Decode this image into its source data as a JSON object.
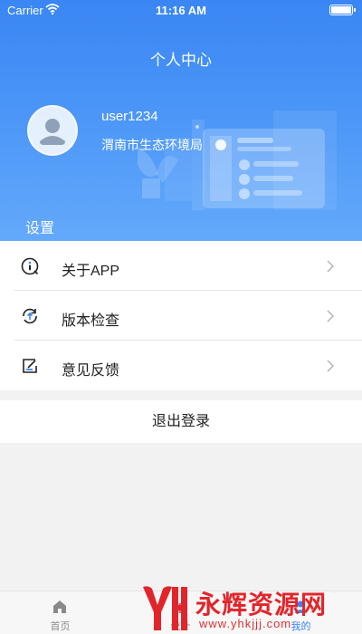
{
  "status_bar": {
    "carrier": "Carrier",
    "time": "11:16 AM"
  },
  "header": {
    "title": "个人中心"
  },
  "profile": {
    "username": "user1234",
    "organization": "渭南市生态环境局"
  },
  "settings": {
    "section_title": "设置",
    "items": [
      {
        "label": "关于APP",
        "icon": "info-icon"
      },
      {
        "label": "版本检查",
        "icon": "update-icon"
      },
      {
        "label": "意见反馈",
        "icon": "feedback-icon"
      }
    ]
  },
  "logout_label": "退出登录",
  "tabbar": {
    "items": [
      {
        "label": "首页",
        "icon": "home-icon"
      },
      {
        "label": "统计",
        "icon": "chart-icon"
      },
      {
        "label": "我的",
        "icon": "user-icon"
      }
    ],
    "active_index": 2
  },
  "watermark": {
    "title": "永辉资源网",
    "url": "www.yhkjjj.com"
  },
  "colors": {
    "primary": "#3a86f4",
    "watermark": "#e2252b"
  }
}
